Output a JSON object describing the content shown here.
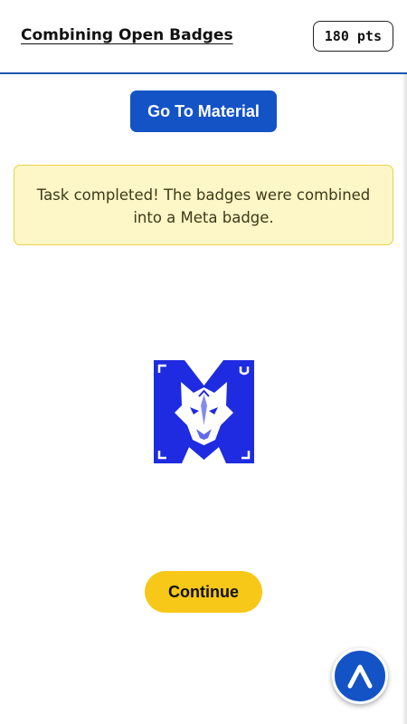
{
  "header": {
    "title": "Combining Open Badges",
    "points": "180 pts"
  },
  "actions": {
    "material_label": "Go To Material",
    "continue_label": "Continue"
  },
  "alert": {
    "message": "Task completed! The badges were combined into a Meta badge."
  },
  "badge": {
    "icon": "meta-badge-wolf-icon",
    "color": "#1e2be0"
  },
  "fab": {
    "icon": "chevron-up-icon",
    "color": "#1453c6"
  }
}
